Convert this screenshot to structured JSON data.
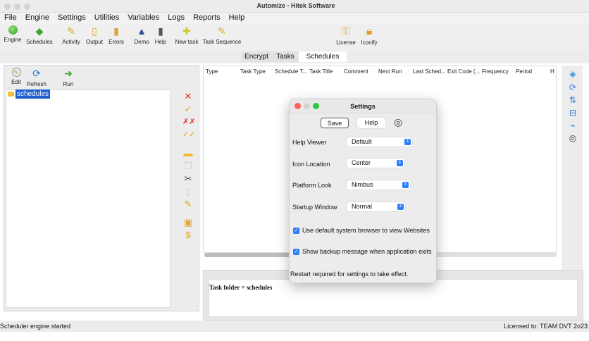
{
  "window": {
    "title": "Automize - Hitek Software"
  },
  "menu": [
    "File",
    "Engine",
    "Settings",
    "Utilities",
    "Variables",
    "Logs",
    "Reports",
    "Help"
  ],
  "toolbar": [
    {
      "label": "Engine",
      "icon": "green-circle-icon"
    },
    {
      "label": "Schedules",
      "icon": "green-diamond-icon"
    },
    {
      "label": "Activity",
      "icon": "notepad-icon"
    },
    {
      "label": "Output",
      "icon": "clipboard-icon"
    },
    {
      "label": "Errors",
      "icon": "error-doc-icon"
    },
    {
      "label": "Demo",
      "icon": "demo-icon"
    },
    {
      "label": "Help",
      "icon": "book-icon"
    },
    {
      "label": "New task",
      "icon": "new-task-icon"
    },
    {
      "label": "Task Sequence",
      "icon": "task-sequence-icon"
    },
    {
      "label": "License",
      "icon": "key-icon"
    },
    {
      "label": "Iconify",
      "icon": "lock-icon"
    }
  ],
  "tabs": [
    {
      "label": "Encrypt"
    },
    {
      "label": "Tasks"
    },
    {
      "label": "Schedules",
      "selected": true
    }
  ],
  "left_toolbar": [
    {
      "label": "Edit"
    },
    {
      "label": "Refresh"
    },
    {
      "label": "Run"
    }
  ],
  "tree": {
    "selected_node": "schedules"
  },
  "table": {
    "columns": [
      "Type",
      "Task Type",
      "Schedule T...",
      "Task Title",
      "Comment",
      "Next Run",
      "Last Sched...",
      "Exit Code (...",
      "Frequency",
      "Period",
      "H"
    ]
  },
  "task_info": "Task folder = schedules",
  "status": {
    "left": "Scheduler engine started",
    "right": "Licensed to: TEAM DVT 2o23"
  },
  "dialog": {
    "title": "Settings",
    "save": "Save",
    "help": "Help",
    "fields": [
      {
        "label": "Help Viewer",
        "value": "Default"
      },
      {
        "label": "Icon Location",
        "value": "Center"
      },
      {
        "label": "Platform Look",
        "value": "Nimbus"
      },
      {
        "label": "Startup Window",
        "value": "Normal"
      }
    ],
    "checkboxes": [
      {
        "label": "Use default system browser to view Websites",
        "checked": true
      },
      {
        "label": "Show backup message when application exits",
        "checked": true
      }
    ],
    "note": "Restart required for settings to take effect."
  },
  "colors": {
    "accent": "#2d7ef7",
    "selection": "#1f5fd1"
  }
}
